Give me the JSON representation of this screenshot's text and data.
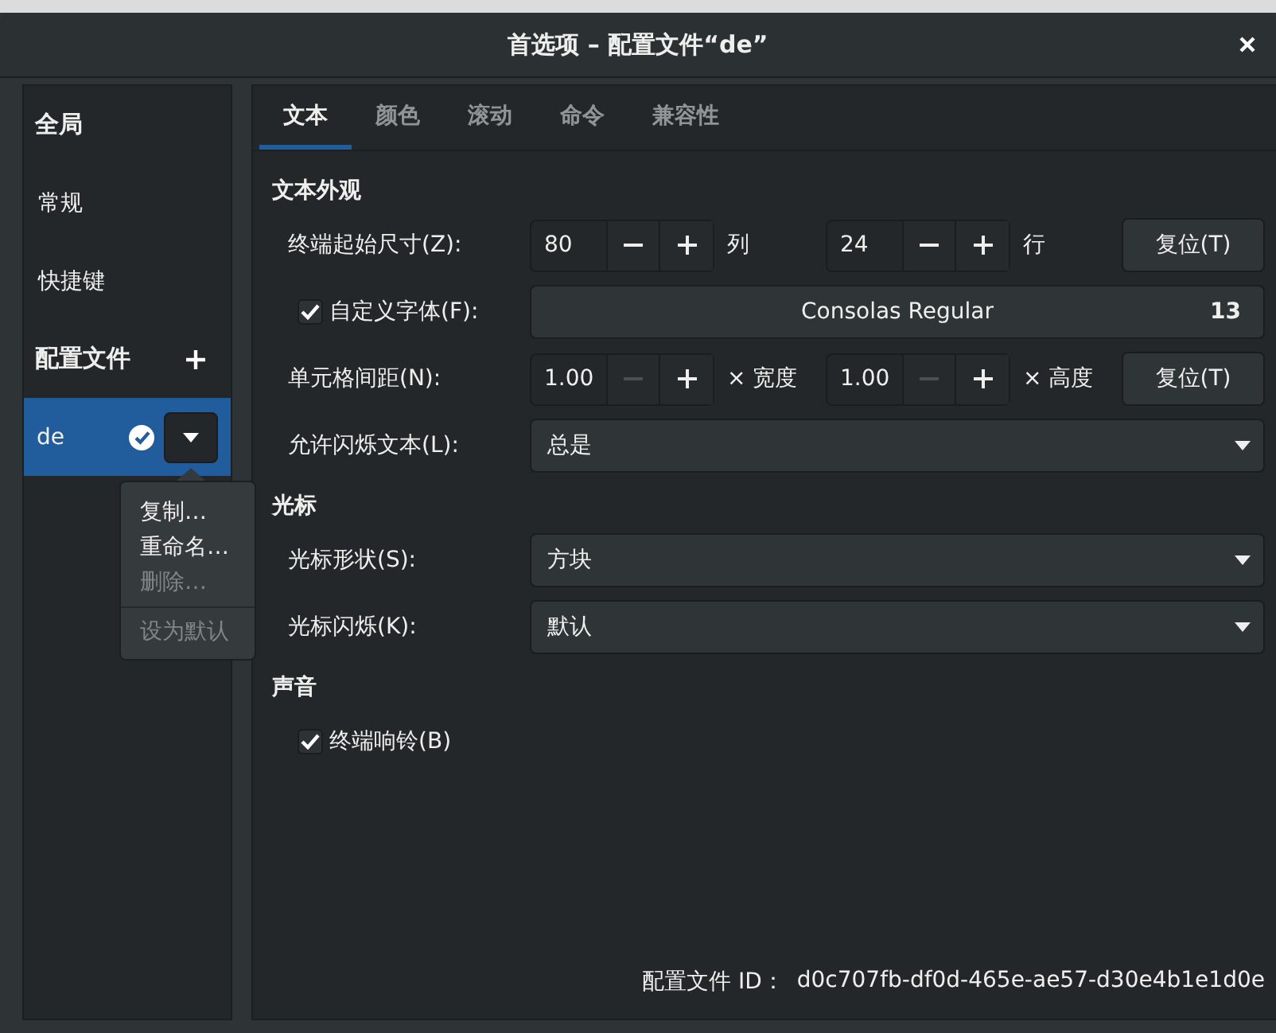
{
  "window": {
    "title": "首选项 – 配置文件“de”"
  },
  "sidebar": {
    "global_heading": "全局",
    "items": [
      {
        "label": "常规",
        "selected": false
      },
      {
        "label": "快捷键",
        "selected": false
      }
    ],
    "profiles_heading": "配置文件",
    "profiles": [
      {
        "name": "de",
        "selected": true,
        "default": true
      }
    ]
  },
  "profile_menu": {
    "items": [
      {
        "label": "复制…",
        "disabled": false,
        "separator_before": false
      },
      {
        "label": "重命名…",
        "disabled": false,
        "separator_before": false
      },
      {
        "label": "删除…",
        "disabled": true,
        "separator_before": false
      },
      {
        "label": "设为默认",
        "disabled": true,
        "separator_before": true
      }
    ]
  },
  "tabs": [
    {
      "label": "文本",
      "selected": true
    },
    {
      "label": "颜色",
      "selected": false
    },
    {
      "label": "滚动",
      "selected": false
    },
    {
      "label": "命令",
      "selected": false
    },
    {
      "label": "兼容性",
      "selected": false
    }
  ],
  "sections": [
    {
      "title": "文本外观",
      "rows": [
        {
          "kind": "spin",
          "label": "终端起始尺寸(Z):",
          "spins": [
            {
              "value": "80",
              "minus_disabled": false,
              "unit": "列"
            },
            {
              "value": "24",
              "minus_disabled": false,
              "unit": "行"
            }
          ],
          "reset": "复位(T)"
        },
        {
          "kind": "font",
          "label": "自定义字体(F):",
          "checked": true,
          "font": "Consolas Regular",
          "size": "13"
        },
        {
          "kind": "spin",
          "label": "单元格间距(N):",
          "spins": [
            {
              "value": "1.00",
              "minus_disabled": true,
              "unit": "× 宽度"
            },
            {
              "value": "1.00",
              "minus_disabled": true,
              "unit": "× 高度"
            }
          ],
          "reset": "复位(T)"
        },
        {
          "kind": "select",
          "label": "允许闪烁文本(L):",
          "value": "总是"
        }
      ]
    },
    {
      "title": "光标",
      "rows": [
        {
          "kind": "select",
          "label": "光标形状(S):",
          "value": "方块"
        },
        {
          "kind": "select",
          "label": "光标闪烁(K):",
          "value": "默认"
        }
      ]
    },
    {
      "title": "声音",
      "rows": [
        {
          "kind": "check",
          "label": "终端响铃(B)",
          "checked": true
        }
      ]
    }
  ],
  "footer": {
    "label": "配置文件 ID：",
    "value": "d0c707fb-df0d-465e-ae57-d30e4b1e1d0e"
  }
}
